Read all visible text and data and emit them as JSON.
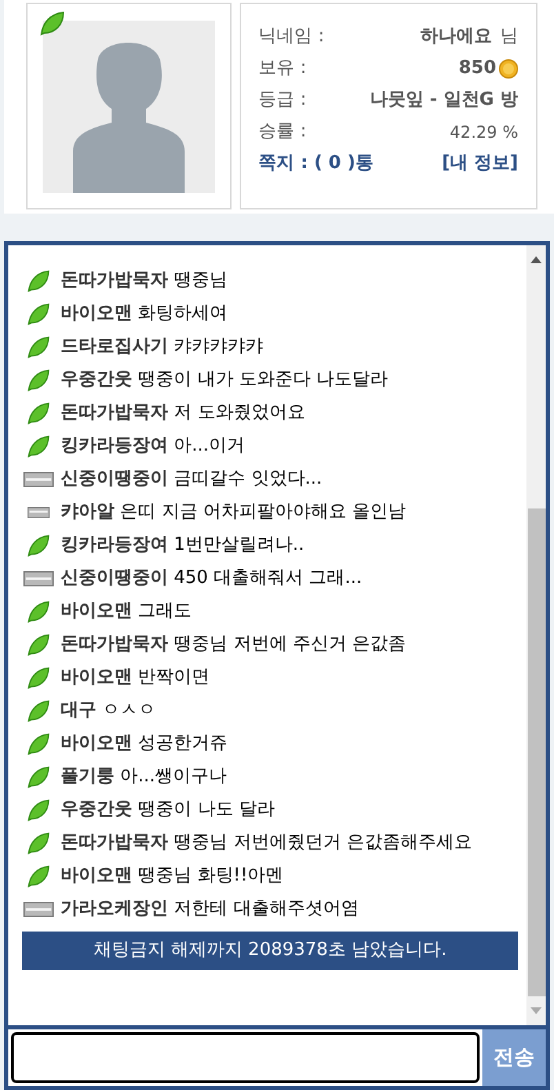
{
  "profile": {
    "nickname_label": "닉네임 :",
    "nickname": "하나에요",
    "nickname_suffix": "님",
    "holdings_label": "보유 :",
    "holdings": "850",
    "grade_label": "등급 :",
    "grade": "나뭇잎 - 일천G 방",
    "winrate_label": "승률 :",
    "winrate": "42.29 %",
    "messages": "쪽지 : ( 0 )통",
    "my_info": "[내 정보]"
  },
  "chat": [
    {
      "kind": "leaf",
      "user": "돈따가밥묵자",
      "text": "땡중님"
    },
    {
      "kind": "leaf",
      "user": "바이오맨",
      "text": "화팅하세여"
    },
    {
      "kind": "leaf",
      "user": "드타로집사기",
      "text": "캬캬캬캬캬"
    },
    {
      "kind": "leaf",
      "user": "우중간웃",
      "text": "땡중이 내가 도와준다 나도달라"
    },
    {
      "kind": "leaf",
      "user": "돈따가밥묵자",
      "text": "저 도와줬었어요"
    },
    {
      "kind": "leaf",
      "user": "킹카라등장여",
      "text": "아...이거"
    },
    {
      "kind": "bar",
      "user": "신중이땡중이",
      "text": "금띠갈수 잇었다..."
    },
    {
      "kind": "thin-bar",
      "user": "캬아알",
      "text": "은띠 지금 어차피팔아야해요 올인남"
    },
    {
      "kind": "leaf",
      "user": "킹카라등장여",
      "text": "1번만살릴려나.."
    },
    {
      "kind": "bar",
      "user": "신중이땡중이",
      "text": "450 대출해줘서 그래..."
    },
    {
      "kind": "leaf",
      "user": "바이오맨",
      "text": "그래도"
    },
    {
      "kind": "leaf",
      "user": "돈따가밥묵자",
      "text": "땡중님 저번에 주신거 은값좀"
    },
    {
      "kind": "leaf",
      "user": "바이오맨",
      "text": "반짝이면"
    },
    {
      "kind": "leaf",
      "user": "대구",
      "text": "ㅇㅅㅇ"
    },
    {
      "kind": "leaf",
      "user": "바이오맨",
      "text": "성공한거쥬"
    },
    {
      "kind": "leaf",
      "user": "풀기룽",
      "text": "아...쌩이구나"
    },
    {
      "kind": "leaf",
      "user": "우중간웃",
      "text": "땡중이 나도 달라"
    },
    {
      "kind": "leaf",
      "user": "돈따가밥묵자",
      "text": "땡중님 저번에줬던거 은값좀해주세요"
    },
    {
      "kind": "leaf",
      "user": "바이오맨",
      "text": "땡중님 화팅!!아멘"
    },
    {
      "kind": "bar",
      "user": "가라오케장인",
      "text": "저한테 대출해주셧어염"
    }
  ],
  "notice": "채팅금지 해제까지 2089378초 남았습니다.",
  "send_button": "전송"
}
